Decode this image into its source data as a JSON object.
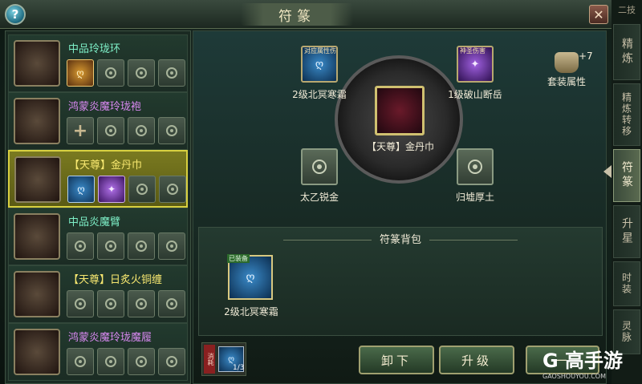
{
  "window": {
    "title": "符篆",
    "help_label": "?",
    "close_label": "✕"
  },
  "equipment_list": [
    {
      "name": "中品玲珑环",
      "name_color": "#7ef0c8",
      "slots": [
        "gold",
        "lock",
        "lock",
        "lock"
      ]
    },
    {
      "name": "鸿蒙炎魔玲珑袍",
      "name_color": "#d888f0",
      "slots": [
        "plus",
        "lock",
        "lock",
        "lock"
      ]
    },
    {
      "name": "【天尊】金丹巾",
      "name_color": "#f8e870",
      "slots": [
        "blue",
        "purple",
        "lock",
        "lock"
      ],
      "selected": true
    },
    {
      "name": "中品炎魔臂",
      "name_color": "#7ef0c8",
      "slots": [
        "lock",
        "lock",
        "lock",
        "lock"
      ]
    },
    {
      "name": "【天尊】日炙火铜缠",
      "name_color": "#f8e870",
      "slots": [
        "lock",
        "lock",
        "lock",
        "lock"
      ]
    },
    {
      "name": "鸿蒙炎魔玲珑魔履",
      "name_color": "#d888f0",
      "slots": [
        "lock",
        "lock",
        "lock",
        "lock"
      ]
    }
  ],
  "wheel": {
    "center_item": "【天尊】金丹巾",
    "slots": [
      {
        "label": "2级北冥寒霜",
        "tag": "对应属性伤",
        "type": "blue"
      },
      {
        "label": "1级破山断岳",
        "tag": "神圣伤害",
        "type": "purple"
      },
      {
        "label": "太乙锐金",
        "type": "empty"
      },
      {
        "label": "归墟厚土",
        "type": "empty"
      }
    ]
  },
  "set_attr": {
    "label": "套装属性",
    "bonus": "+7"
  },
  "bag": {
    "title": "符篆背包",
    "items": [
      {
        "label": "2级北冥寒霜",
        "badge": "已装备",
        "type": "blue"
      }
    ]
  },
  "consume": {
    "tag": "消耗",
    "count": "1/3"
  },
  "actions": {
    "unload": "卸下",
    "upgrade": "升级",
    "third": "一"
  },
  "right_tabs": {
    "top": "二技",
    "tabs": [
      "精炼",
      "精炼转移",
      "符篆",
      "升星",
      "时装",
      "灵脉"
    ],
    "active": "符篆"
  },
  "watermark": {
    "logo": "G 高手游",
    "site": "GAOSHOUYOU.COM"
  }
}
